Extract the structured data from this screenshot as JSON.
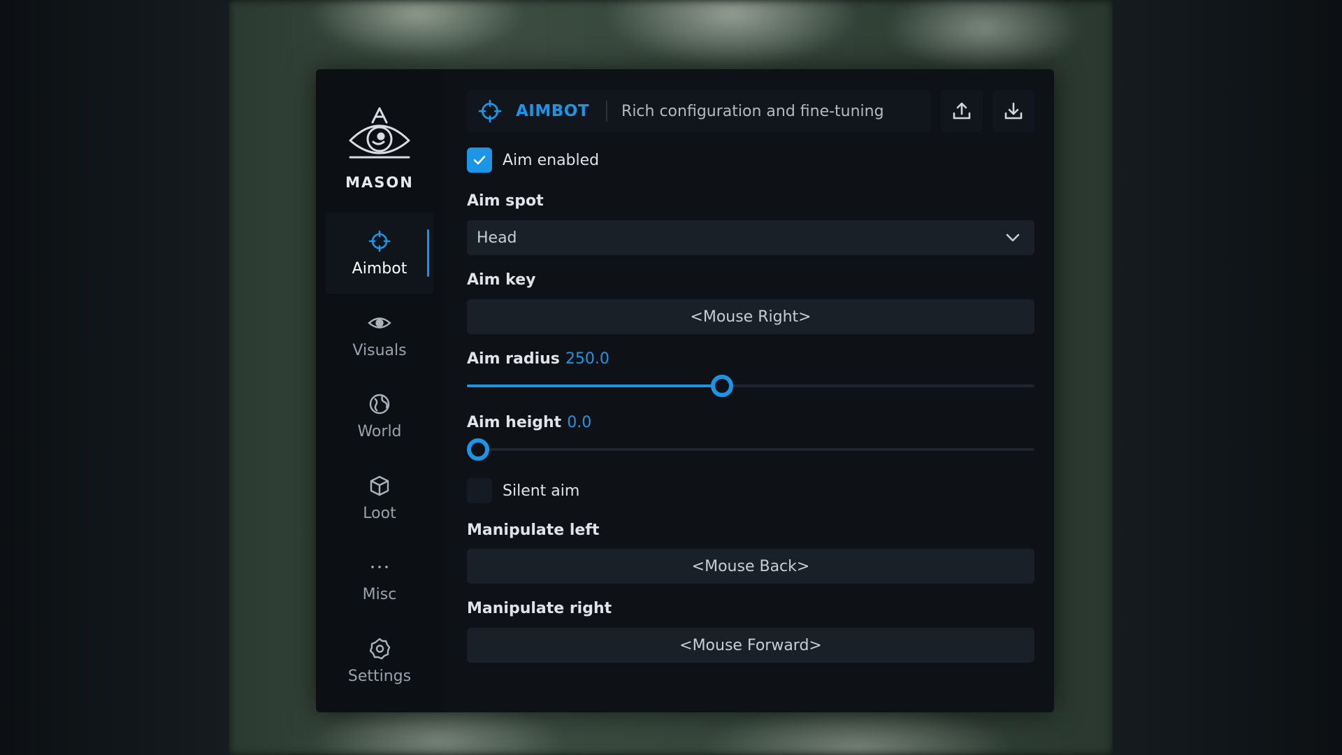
{
  "brand": {
    "name": "MASON"
  },
  "nav": [
    {
      "id": "aimbot",
      "label": "Aimbot",
      "icon": "crosshair-icon",
      "active": true
    },
    {
      "id": "visuals",
      "label": "Visuals",
      "icon": "eye-icon",
      "active": false
    },
    {
      "id": "world",
      "label": "World",
      "icon": "globe-icon",
      "active": false
    },
    {
      "id": "loot",
      "label": "Loot",
      "icon": "box-icon",
      "active": false
    },
    {
      "id": "misc",
      "label": "Misc",
      "icon": "more-dots-icon",
      "active": false
    },
    {
      "id": "settings",
      "label": "Settings",
      "icon": "gear-icon",
      "active": false
    }
  ],
  "header": {
    "title": "AIMBOT",
    "subtitle": "Rich configuration and fine-tuning",
    "upload_icon": "upload-icon",
    "download_icon": "download-icon"
  },
  "aim_enabled": {
    "label": "Aim enabled",
    "checked": true
  },
  "aim_spot": {
    "label": "Aim spot",
    "value": "Head"
  },
  "aim_key": {
    "label": "Aim key",
    "value": "<Mouse Right>"
  },
  "aim_radius": {
    "label": "Aim radius",
    "value": "250.0",
    "fraction": 0.45
  },
  "aim_height": {
    "label": "Aim height",
    "value": "0.0",
    "fraction": 0.0
  },
  "silent_aim": {
    "label": "Silent aim",
    "checked": false
  },
  "manipulate_left": {
    "label": "Manipulate left",
    "value": "<Mouse Back>"
  },
  "manipulate_right": {
    "label": "Manipulate right",
    "value": "<Mouse Forward>"
  },
  "colors": {
    "accent": "#1b95e6",
    "panel": "#0e1217",
    "field": "#1a2028"
  }
}
